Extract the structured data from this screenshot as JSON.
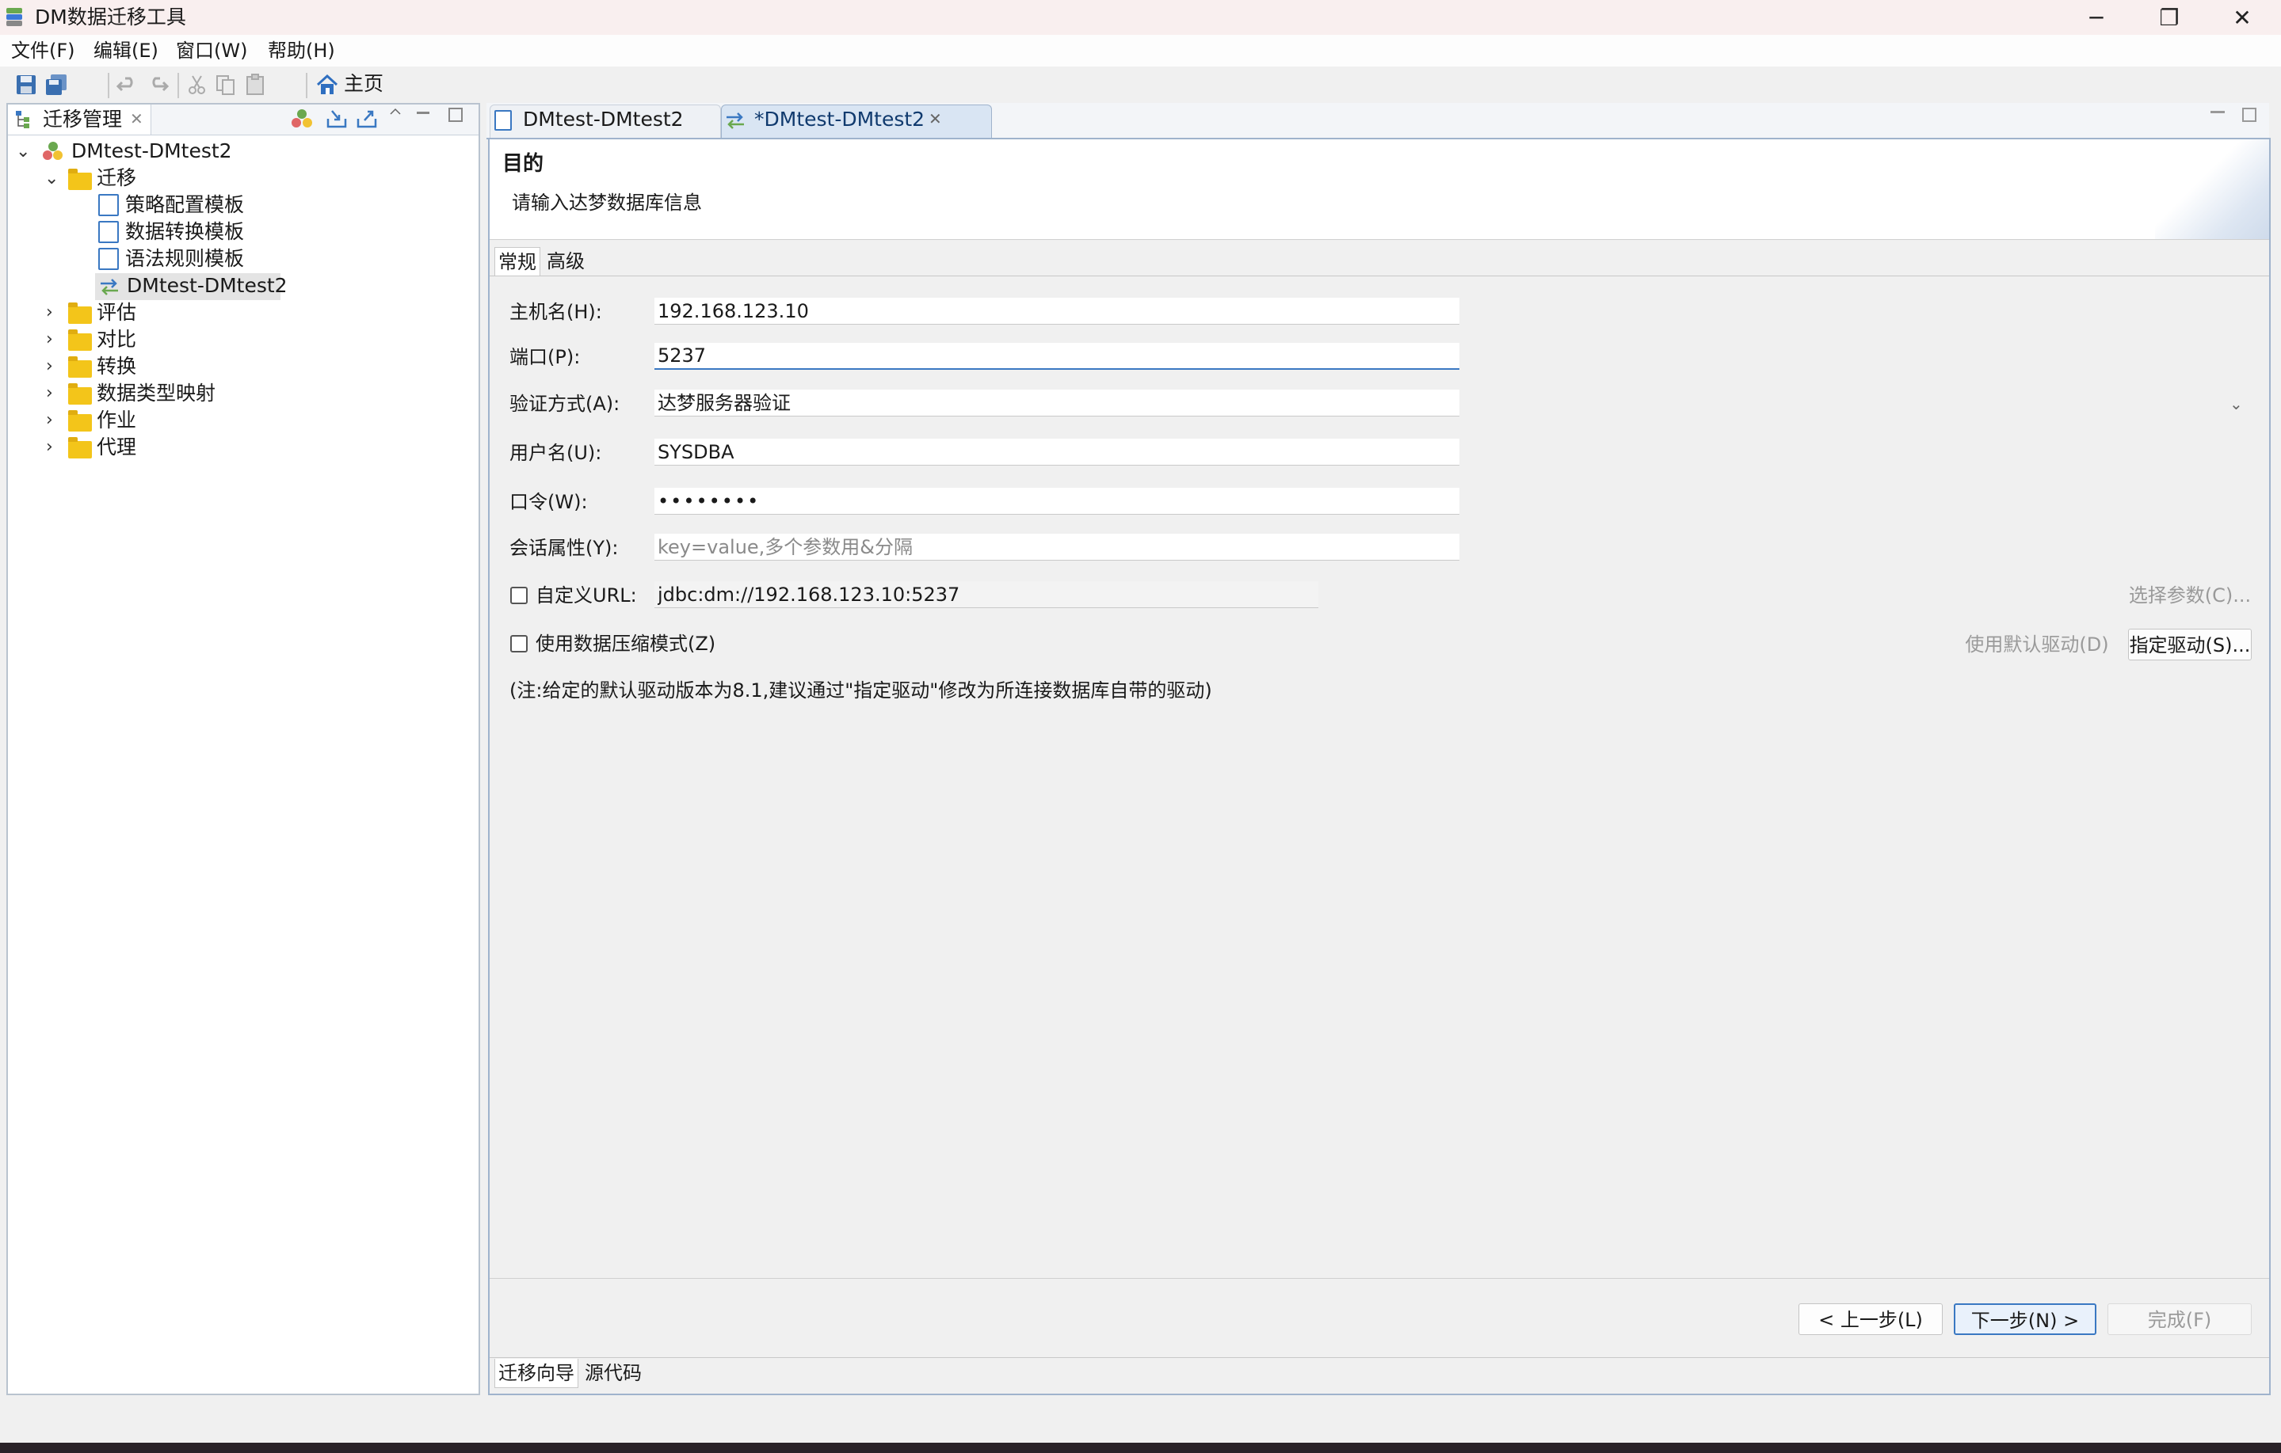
{
  "window": {
    "title": "DM数据迁移工具",
    "minimize_glyph": "─",
    "restore_glyph": "❐",
    "close_glyph": "✕"
  },
  "menu": [
    "文件(F)",
    "编辑(E)",
    "窗口(W)",
    "帮助(H)"
  ],
  "toolbar": {
    "home_label": "主页",
    "icons": [
      "save-icon",
      "save-all-icon",
      "undo-icon",
      "redo-icon",
      "cut-icon",
      "copy-icon",
      "paste-icon",
      "home-icon"
    ]
  },
  "left_panel": {
    "tab_label": "迁移管理",
    "tab_close": "✕",
    "tree": {
      "root": "DMtest-DMtest2",
      "migration_folder": "迁移",
      "migration_children": [
        "策略配置模板",
        "数据转换模板",
        "语法规则模板",
        "DMtest-DMtest2"
      ],
      "folders": [
        "评估",
        "对比",
        "转换",
        "数据类型映射",
        "作业",
        "代理"
      ]
    }
  },
  "editor": {
    "tabs": [
      "DMtest-DMtest2",
      "*DMtest-DMtest2"
    ],
    "tab_close": "✕",
    "header_title": "目的",
    "header_desc": "请输入达梦数据库信息",
    "subtabs": [
      "常规",
      "高级"
    ],
    "form": {
      "host_label": "主机名(H):",
      "host_value": "192.168.123.10",
      "port_label": "端口(P):",
      "port_value": "5237",
      "auth_label": "验证方式(A):",
      "auth_value": "达梦服务器验证",
      "user_label": "用户名(U):",
      "user_value": "SYSDBA",
      "password_label": "口令(W):",
      "password_value": "••••••••",
      "session_label": "会话属性(Y):",
      "session_placeholder": "key=value,多个参数用&分隔",
      "custom_url_label": "自定义URL:",
      "custom_url_value": "jdbc:dm://192.168.123.10:5237",
      "custom_url_checked": false,
      "select_params_label": "选择参数(C)...",
      "compress_label": "使用数据压缩模式(Z)",
      "compress_checked": false,
      "default_driver_label": "使用默认驱动(D)",
      "specify_driver_label": "指定驱动(S)...",
      "note": "(注:给定的默认驱动版本为8.1,建议通过\"指定驱动\"修改为所连接数据库自带的驱动)"
    },
    "buttons": {
      "prev": "< 上一步(L)",
      "next": "下一步(N) >",
      "finish": "完成(F)"
    },
    "bottom_tabs": [
      "迁移向导",
      "源代码"
    ]
  },
  "colors": {
    "accent": "#3a78c2",
    "folder": "#f3c51a",
    "tab_active": "#d9e5f3",
    "titlebar": "#f9efef"
  }
}
